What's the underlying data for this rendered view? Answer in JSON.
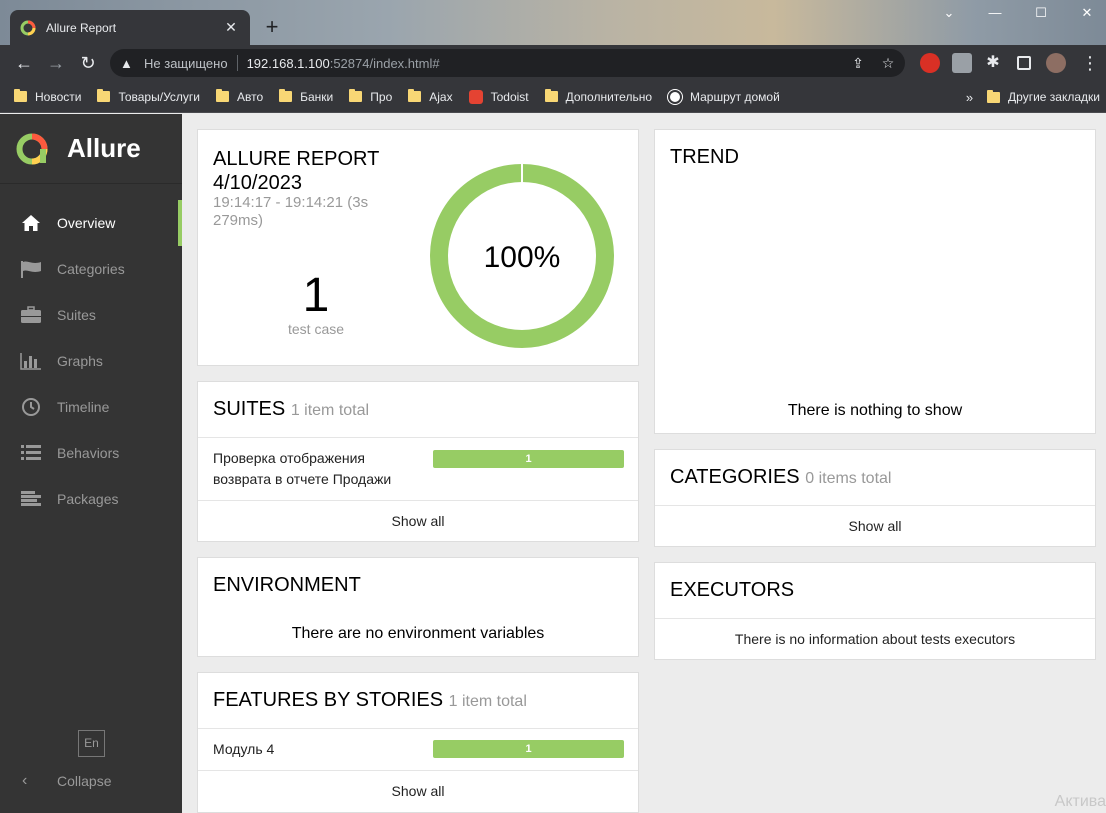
{
  "browser": {
    "tab_title": "Allure Report",
    "new_tab": "+",
    "insecure_label": "Не защищено",
    "url_host": "192.168.1.100",
    "url_rest": ":52874/index.html#",
    "bookmarks": [
      "Новости",
      "Товары/Услуги",
      "Авто",
      "Банки",
      "Про",
      "Ajax",
      "Todoist",
      "Дополнительно",
      "Маршрут домой"
    ],
    "more_bookmarks": "»",
    "other_bookmarks": "Другие закладки"
  },
  "sidebar": {
    "brand": "Allure",
    "items": [
      {
        "label": "Overview",
        "icon": "home-icon"
      },
      {
        "label": "Categories",
        "icon": "flag-icon"
      },
      {
        "label": "Suites",
        "icon": "briefcase-icon"
      },
      {
        "label": "Graphs",
        "icon": "bar-chart-icon"
      },
      {
        "label": "Timeline",
        "icon": "clock-icon"
      },
      {
        "label": "Behaviors",
        "icon": "list-icon"
      },
      {
        "label": "Packages",
        "icon": "align-left-icon"
      }
    ],
    "language": "En",
    "collapse": "Collapse"
  },
  "summary": {
    "title": "ALLURE REPORT",
    "date": "4/10/2023",
    "time_range": "19:14:17 - 19:14:21 (3s 279ms)",
    "test_count": "1",
    "test_label": "test case",
    "percent": "100%",
    "passed_fraction": 1.0,
    "pass_color": "#97cc64"
  },
  "suites": {
    "title": "SUITES",
    "subtitle": "1 item total",
    "rows": [
      {
        "name": "Проверка отображения возврата в отчете Продажи",
        "count": "1"
      }
    ],
    "show_all": "Show all"
  },
  "environment": {
    "title": "ENVIRONMENT",
    "message": "There are no environment variables"
  },
  "features": {
    "title": "FEATURES BY STORIES",
    "subtitle": "1 item total",
    "rows": [
      {
        "name": "Модуль 4",
        "count": "1"
      }
    ],
    "show_all": "Show all"
  },
  "trend": {
    "title": "TREND",
    "message": "There is nothing to show"
  },
  "categories": {
    "title": "CATEGORIES",
    "subtitle": "0 items total",
    "show_all": "Show all"
  },
  "executors": {
    "title": "EXECUTORS",
    "message": "There is no information about tests executors"
  },
  "watermark": "Актива"
}
